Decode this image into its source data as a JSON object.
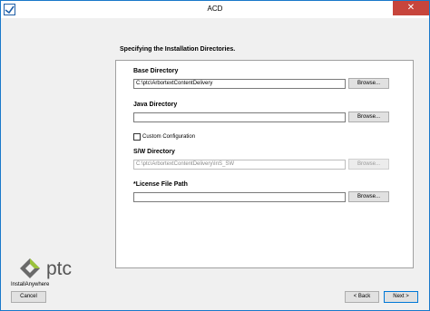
{
  "window": {
    "title": "ACD",
    "close_glyph": "✕"
  },
  "heading": "Specifying the Installation Directories.",
  "base_directory": {
    "label": "Base Directory",
    "value": "C:\\ptc\\ArbortextContentDelivery",
    "browse": "Browse..."
  },
  "java_directory": {
    "label": "Java Directory",
    "value": "",
    "browse": "Browse..."
  },
  "custom_configuration": {
    "label": "Custom Configuration",
    "checked": false
  },
  "sw_directory": {
    "label": "S/W Directory",
    "value": "C:\\ptc\\ArbortextContentDelivery\\InS_SW",
    "browse": "Browse..."
  },
  "license_file": {
    "label": "*License File Path",
    "value": "",
    "browse": "Browse..."
  },
  "branding": {
    "logo_text": "ptc",
    "installer": "InstallAnywhere"
  },
  "footer": {
    "cancel": "Cancel",
    "back": "< Back",
    "next": "Next >"
  },
  "colors": {
    "accent": "#0078d7",
    "close": "#c7453c",
    "logo": "#555555"
  },
  "icons": {
    "app": "app-window-icon",
    "logo": "ptc-logo-icon"
  }
}
